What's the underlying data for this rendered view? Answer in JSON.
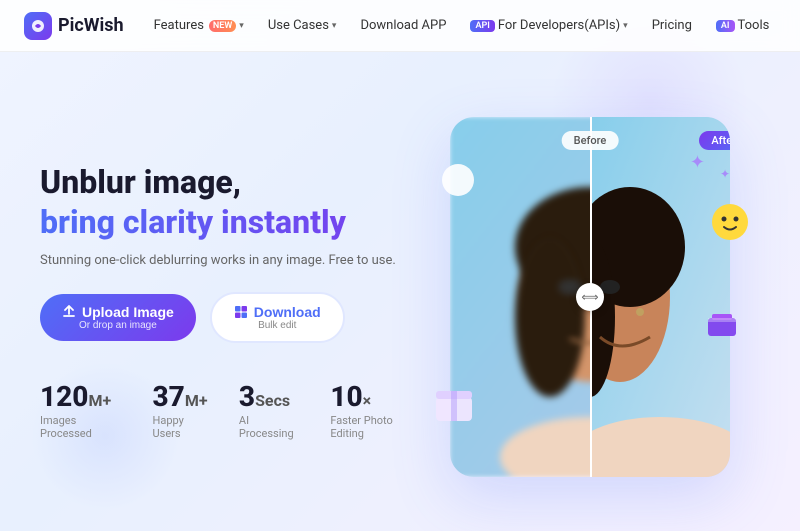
{
  "brand": {
    "name": "PicWish",
    "logo_char": "🎨"
  },
  "nav": {
    "items": [
      {
        "id": "features",
        "label": "Features",
        "has_dropdown": true,
        "badge": "new"
      },
      {
        "id": "use-cases",
        "label": "Use Cases",
        "has_dropdown": true
      },
      {
        "id": "download",
        "label": "Download APP",
        "has_dropdown": false
      },
      {
        "id": "for-developers",
        "label": "For Developers(APIs)",
        "has_dropdown": true,
        "badge": "api"
      },
      {
        "id": "pricing",
        "label": "Pricing",
        "has_dropdown": false
      },
      {
        "id": "tools",
        "label": "Tools",
        "has_dropdown": false,
        "badge": "ai"
      }
    ]
  },
  "hero": {
    "title_line1": "Unblur image,",
    "title_line2": "bring clarity instantly",
    "subtitle": "Stunning one-click deblurring works in any image. Free to use.",
    "cta_upload_main": "Upload Image",
    "cta_upload_sub": "Or drop an image",
    "cta_download_main": "Download",
    "cta_download_sub": "Bulk edit",
    "badge_before": "Before",
    "badge_after": "After"
  },
  "stats": [
    {
      "number": "120",
      "unit": "M+",
      "label": "Images Processed"
    },
    {
      "number": "37",
      "unit": "M+",
      "label": "Happy Users"
    },
    {
      "number": "3",
      "unit": "Secs",
      "label": "AI Processing"
    },
    {
      "number": "10",
      "unit": "×",
      "label": "Faster Photo Editing"
    }
  ],
  "colors": {
    "primary": "#4f6ef7",
    "secondary": "#7c3aed",
    "text_dark": "#1a1a2e",
    "text_gray": "#666666"
  }
}
